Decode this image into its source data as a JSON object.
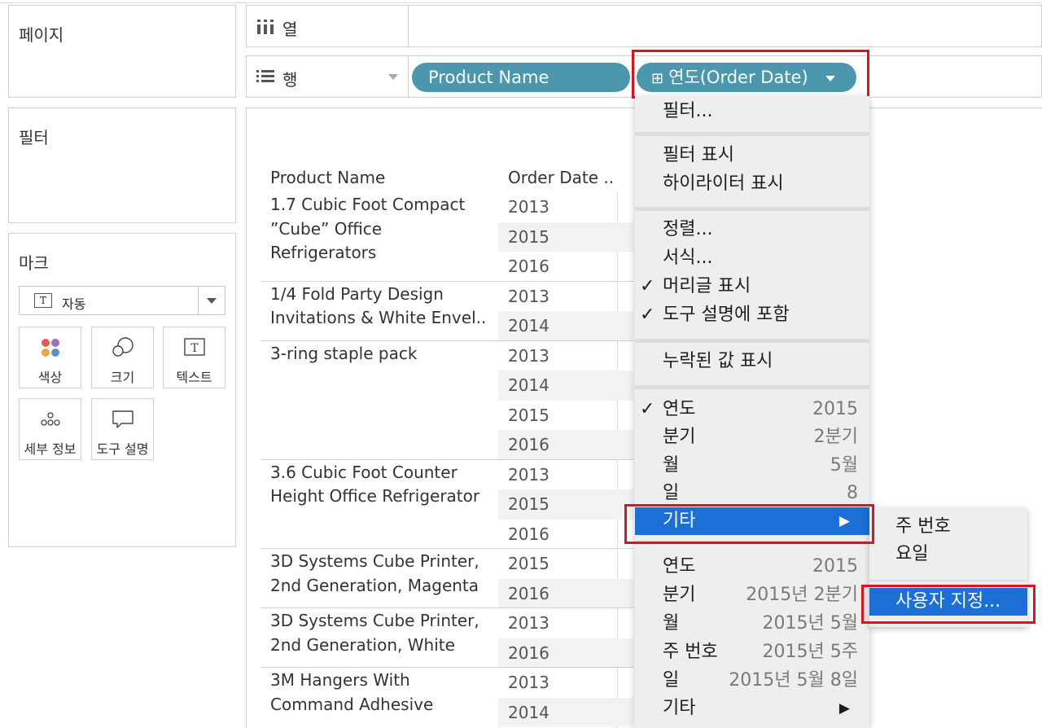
{
  "panels": {
    "pages_title": "페이지",
    "filters_title": "필터",
    "marks_title": "마크"
  },
  "marks": {
    "type_label": "자동",
    "type_icon": "T",
    "buttons": [
      {
        "label": "색상",
        "icon": "color-dots-icon"
      },
      {
        "label": "크기",
        "icon": "size-circles-icon"
      },
      {
        "label": "텍스트",
        "icon": "text-box-icon"
      },
      {
        "label": "세부 정보",
        "icon": "detail-dots-icon"
      },
      {
        "label": "도구 설명",
        "icon": "tooltip-bubble-icon"
      }
    ]
  },
  "shelves": {
    "columns_label": "열",
    "rows_label": "행",
    "rows_pills": [
      "Product Name",
      "연도(Order Date)"
    ],
    "date_pill_icon": "⊞"
  },
  "table": {
    "headers": [
      "Product Name",
      "Order Date .."
    ],
    "groups": [
      {
        "name": [
          "1.7 Cubic Foot Compact",
          "”Cube” Office",
          "Refrigerators"
        ],
        "years": [
          "2013",
          "2015",
          "2016"
        ]
      },
      {
        "name": [
          "1/4 Fold Party Design",
          "Invitations & White Envel.."
        ],
        "years": [
          "2013",
          "2014"
        ]
      },
      {
        "name": [
          "3-ring staple pack"
        ],
        "years": [
          "2013",
          "2014",
          "2015",
          "2016"
        ]
      },
      {
        "name": [
          "3.6 Cubic Foot Counter",
          "Height Office Refrigerator"
        ],
        "years": [
          "2013",
          "2015",
          "2016"
        ]
      },
      {
        "name": [
          "3D Systems Cube Printer,",
          "2nd Generation, Magenta"
        ],
        "years": [
          "2015",
          "2016"
        ]
      },
      {
        "name": [
          "3D Systems Cube Printer,",
          "2nd Generation, White"
        ],
        "years": [
          "2013",
          "2016"
        ]
      },
      {
        "name": [
          "3M Hangers With",
          "Command Adhesive"
        ],
        "years": [
          "2013",
          "2014"
        ]
      }
    ]
  },
  "menu": {
    "filter": "필터...",
    "show_filter": "필터 표시",
    "show_highlighter": "하이라이터 표시",
    "sort": "정렬...",
    "format": "서식...",
    "show_header": "머리글 표시",
    "include_in_tooltip": "도구 설명에 포함",
    "show_missing": "누락된 값 표시",
    "discrete": [
      {
        "label": "연도",
        "value": "2015",
        "checked": true
      },
      {
        "label": "분기",
        "value": "2분기"
      },
      {
        "label": "월",
        "value": "5월"
      },
      {
        "label": "일",
        "value": "8"
      },
      {
        "label": "기타",
        "value": ""
      }
    ],
    "continuous": [
      {
        "label": "연도",
        "value": "2015"
      },
      {
        "label": "분기",
        "value": "2015년 2분기"
      },
      {
        "label": "월",
        "value": "2015년 5월"
      },
      {
        "label": "주 번호",
        "value": "2015년 5주"
      },
      {
        "label": "일",
        "value": "2015년 5월 8일"
      },
      {
        "label": "기타",
        "value": ""
      }
    ],
    "check_glyph": "✓",
    "arrow_glyph": "▶"
  },
  "submenu": {
    "week_number": "주 번호",
    "weekday": "요일",
    "custom": "사용자 지정..."
  },
  "colors": {
    "pill": "#4a97ae",
    "selection": "#1b6fd6",
    "highlight_box": "#e0131b"
  }
}
